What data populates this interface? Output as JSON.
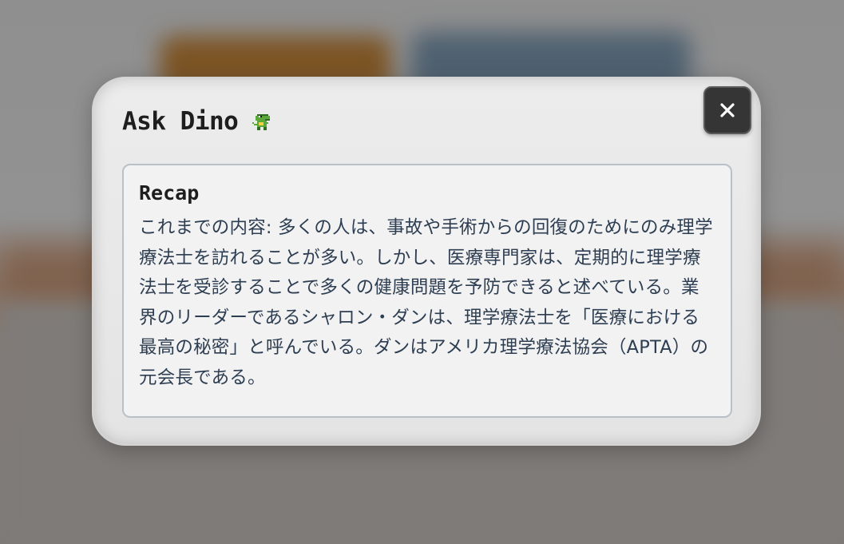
{
  "dialog": {
    "title": "Ask Dino",
    "title_icon": "dino-icon",
    "close_icon": "close-icon",
    "close_label": "✕"
  },
  "recap": {
    "heading": "Recap",
    "body": "これまでの内容: 多くの人は、事故や手術からの回復のためにのみ理学療法士を訪れることが多い。しかし、医療専門家は、定期的に理学療法士を受診することで多くの健康問題を予防できると述べている。業界のリーダーであるシャロン・ダンは、理学療法士を「医療における最高の秘密」と呼んでいる。ダンはアメリカ理学療法協会（APTA）の元会長である。"
  },
  "colors": {
    "close_button_bg": "#353535",
    "dino_green": "#5aa83a",
    "body_text": "#2e3e52",
    "card_border": "#b8c0c8"
  }
}
